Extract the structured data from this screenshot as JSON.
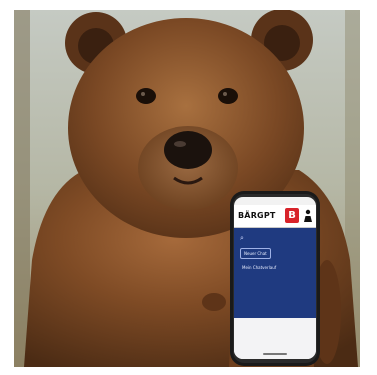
{
  "scene": {
    "subject": "brown bear holding smartphone",
    "colors": {
      "fur": "#6b3f1f",
      "background": "#b7b9a9",
      "screen_blue": "#1f3a80",
      "badge_red": "#d8232a"
    }
  },
  "phone": {
    "app_logo": "BÄRGPT",
    "badge_letter": "B",
    "pill_text": "Neuer Chat",
    "body_text": "Mein Chatverlauf"
  }
}
